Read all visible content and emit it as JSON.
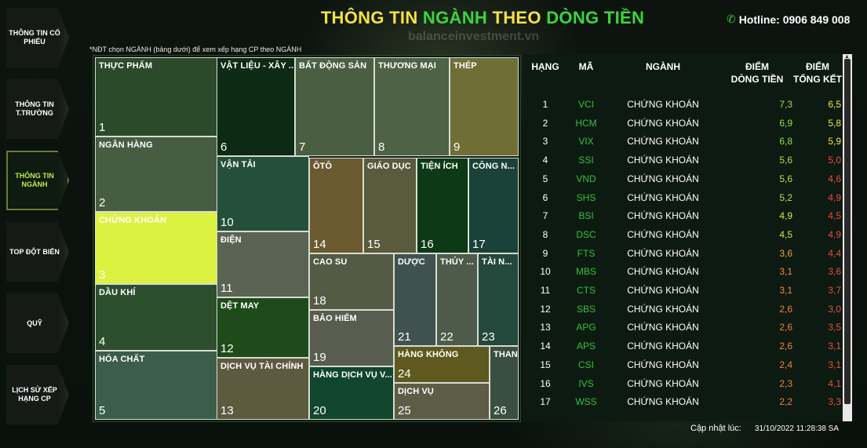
{
  "header": {
    "title_p1": "THÔNG TIN ",
    "title_p2": "NGÀNH ",
    "title_p3": "THEO ",
    "title_p4": "DÒNG TIỀN",
    "watermark": "balanceinvestment.vn",
    "hotline": "Hotline: 0906 849 008",
    "note": "*NĐT chọn NGÀNH (bảng dưới) để xem xếp hạng CP theo NGÀNH"
  },
  "nav": [
    {
      "label": "THÔNG TIN CỔ PHIẾU",
      "active": false
    },
    {
      "label": "THÔNG TIN T.TRƯỜNG",
      "active": false
    },
    {
      "label": "THÔNG TIN NGÀNH",
      "active": true
    },
    {
      "label": "TOP ĐỘT BIẾN",
      "active": false
    },
    {
      "label": "QUỸ",
      "active": false
    },
    {
      "label": "LỊCH SỬ XẾP HẠNG CP",
      "active": false
    }
  ],
  "treemap": [
    {
      "name": "THỰC PHẨM",
      "rank": "1",
      "color": "#2b4a2a"
    },
    {
      "name": "NGÂN HÀNG",
      "rank": "2",
      "color": "#465d42"
    },
    {
      "name": "CHỨNG KHOÁN",
      "rank": "3",
      "color": "#dcf240"
    },
    {
      "name": "DẦU KHÍ",
      "rank": "4",
      "color": "#2d4f2e"
    },
    {
      "name": "HÓA CHẤT",
      "rank": "5",
      "color": "#3d5d4b"
    },
    {
      "name": "VẬT LIỆU - XÂY ...",
      "rank": "6",
      "color": "#0d2a14"
    },
    {
      "name": "BẤT ĐỘNG SẢN",
      "rank": "7",
      "color": "#4a5f42"
    },
    {
      "name": "THƯƠNG MẠI",
      "rank": "8",
      "color": "#4e6246"
    },
    {
      "name": "THÉP",
      "rank": "9",
      "color": "#6f6e36"
    },
    {
      "name": "VẬN TẢI",
      "rank": "10",
      "color": "#24503a"
    },
    {
      "name": "ĐIỆN",
      "rank": "11",
      "color": "#5b6352"
    },
    {
      "name": "DỆT MAY",
      "rank": "12",
      "color": "#1f4a1a"
    },
    {
      "name": "DỊCH VỤ TÀI CHÍNH",
      "rank": "13",
      "color": "#5e5a40"
    },
    {
      "name": "ÔTÔ",
      "rank": "14",
      "color": "#6b5a30"
    },
    {
      "name": "GIÁO DỤC",
      "rank": "15",
      "color": "#5a5a3c"
    },
    {
      "name": "TIỆN ÍCH",
      "rank": "16",
      "color": "#0c3a16"
    },
    {
      "name": "CÔNG N...",
      "rank": "17",
      "color": "#1b4238"
    },
    {
      "name": "CAO SU",
      "rank": "18",
      "color": "#545a44"
    },
    {
      "name": "BẢO HIỂM",
      "rank": "19",
      "color": "#585d4f"
    },
    {
      "name": "HÀNG DỊCH VỤ V...",
      "rank": "20",
      "color": "#10452e"
    },
    {
      "name": "DƯỢC",
      "rank": "21",
      "color": "#3f5250"
    },
    {
      "name": "THỦY ...",
      "rank": "22",
      "color": "#4e5b4a"
    },
    {
      "name": "TÀI N...",
      "rank": "23",
      "color": "#23483c"
    },
    {
      "name": "HÀNG KHÔNG",
      "rank": "24",
      "color": "#5e5a1f"
    },
    {
      "name": "DỊCH VỤ",
      "rank": "25",
      "color": "#5d5c45"
    },
    {
      "name": "THAN",
      "rank": "26",
      "color": "#3a4f42"
    }
  ],
  "table": {
    "headers": {
      "rank": "HẠNG",
      "code": "MÃ",
      "sector": "NGÀNH",
      "flow_1": "ĐIỂM",
      "flow_2": "DÒNG TIỀN",
      "total_1": "ĐIỂM",
      "total_2": "TỔNG KẾT"
    },
    "rows": [
      {
        "rank": "1",
        "code": "VCI",
        "sector": "CHỨNG KHOÁN",
        "flow": "7,3",
        "total": "6,5",
        "flow_color": "#8ee64a",
        "total_color": "#f2e54a"
      },
      {
        "rank": "2",
        "code": "HCM",
        "sector": "CHỨNG KHOÁN",
        "flow": "6,9",
        "total": "5,8",
        "flow_color": "#8ee64a",
        "total_color": "#f2e54a"
      },
      {
        "rank": "3",
        "code": "VIX",
        "sector": "CHỨNG KHOÁN",
        "flow": "6,8",
        "total": "5,9",
        "flow_color": "#8ee64a",
        "total_color": "#f2e54a"
      },
      {
        "rank": "4",
        "code": "SSI",
        "sector": "CHỨNG KHOÁN",
        "flow": "5,6",
        "total": "5,0",
        "flow_color": "#b6dd48",
        "total_color": "#ef4a3a"
      },
      {
        "rank": "5",
        "code": "VND",
        "sector": "CHỨNG KHOÁN",
        "flow": "5,6",
        "total": "4,6",
        "flow_color": "#b6dd48",
        "total_color": "#ef4a3a"
      },
      {
        "rank": "6",
        "code": "SHS",
        "sector": "CHỨNG KHOÁN",
        "flow": "5,2",
        "total": "4,9",
        "flow_color": "#b6dd48",
        "total_color": "#ef4a3a"
      },
      {
        "rank": "7",
        "code": "BSI",
        "sector": "CHỨNG KHOÁN",
        "flow": "4,9",
        "total": "4,5",
        "flow_color": "#dfe34a",
        "total_color": "#ef4a3a"
      },
      {
        "rank": "8",
        "code": "DSC",
        "sector": "CHỨNG KHOÁN",
        "flow": "4,5",
        "total": "4,9",
        "flow_color": "#dfe34a",
        "total_color": "#ef4a3a"
      },
      {
        "rank": "9",
        "code": "FTS",
        "sector": "CHỨNG KHOÁN",
        "flow": "3,6",
        "total": "4,4",
        "flow_color": "#f0a23a",
        "total_color": "#ef4a3a"
      },
      {
        "rank": "10",
        "code": "MBS",
        "sector": "CHỨNG KHOÁN",
        "flow": "3,1",
        "total": "3,6",
        "flow_color": "#f08a3a",
        "total_color": "#ef4a3a"
      },
      {
        "rank": "11",
        "code": "CTS",
        "sector": "CHỨNG KHOÁN",
        "flow": "3,1",
        "total": "3,7",
        "flow_color": "#f08a3a",
        "total_color": "#ef4a3a"
      },
      {
        "rank": "12",
        "code": "SBS",
        "sector": "CHỨNG KHOÁN",
        "flow": "2,6",
        "total": "3,0",
        "flow_color": "#f0823a",
        "total_color": "#ef4a3a"
      },
      {
        "rank": "13",
        "code": "APG",
        "sector": "CHỨNG KHOÁN",
        "flow": "2,6",
        "total": "3,5",
        "flow_color": "#f0823a",
        "total_color": "#ef4a3a"
      },
      {
        "rank": "14",
        "code": "APS",
        "sector": "CHỨNG KHOÁN",
        "flow": "2,6",
        "total": "3,1",
        "flow_color": "#f0823a",
        "total_color": "#ef4a3a"
      },
      {
        "rank": "15",
        "code": "CSI",
        "sector": "CHỨNG KHOÁN",
        "flow": "2,4",
        "total": "3,1",
        "flow_color": "#f0823a",
        "total_color": "#ef4a3a"
      },
      {
        "rank": "16",
        "code": "IVS",
        "sector": "CHỨNG KHOÁN",
        "flow": "2,3",
        "total": "4,1",
        "flow_color": "#f0823a",
        "total_color": "#ef4a3a"
      },
      {
        "rank": "17",
        "code": "WSS",
        "sector": "CHỨNG KHOÁN",
        "flow": "2,2",
        "total": "3,3",
        "flow_color": "#f0823a",
        "total_color": "#ef4a3a"
      }
    ]
  },
  "footer": {
    "updated_label": "Cập nhật lúc:",
    "updated_value": "31/10/2022 11:28:38 SA"
  }
}
